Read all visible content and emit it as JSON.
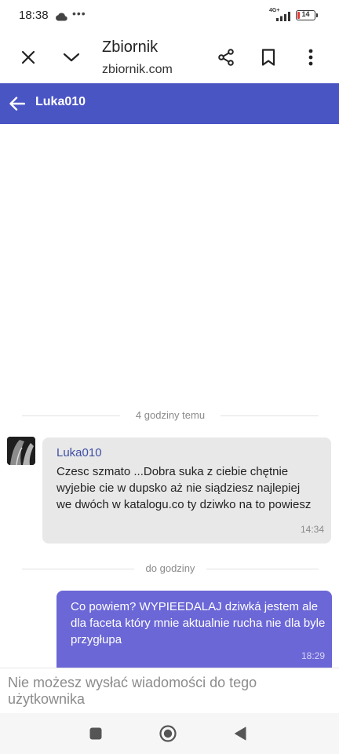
{
  "status_bar": {
    "time": "18:38",
    "network": "4G+",
    "battery": "14",
    "icons": [
      "cloud-icon",
      "more-dots-icon",
      "signal-icon",
      "battery-icon"
    ]
  },
  "browser": {
    "title": "Zbiornik",
    "url": "zbiornik.com",
    "icons": [
      "close-icon",
      "chevron-down-icon",
      "share-icon",
      "bookmark-icon",
      "more-vert-icon"
    ]
  },
  "header": {
    "title": "Luka010",
    "background": "#4a55c4"
  },
  "chat": {
    "dividers": [
      "4 godziny temu",
      "do godziny"
    ],
    "messages": [
      {
        "direction": "incoming",
        "sender": "Luka010",
        "text": "Czesc szmato ...Dobra suka z ciebie chętnie wyjebie cie w dupsko aż nie siądziesz najlepiej we dwóch w katalogu.co ty dziwko na to powiesz",
        "time": "14:34",
        "bubble_color": "#e8e8e8"
      },
      {
        "direction": "outgoing",
        "text": "Co powiem? WYPIEEDALAJ dziwká jestem ale dla faceta który mnie aktualnie rucha nie dla byle przygłupa",
        "time": "18:29",
        "bubble_color": "#6b67d6"
      }
    ]
  },
  "footer": {
    "note": "Nie możesz wysłać wiadomości do tego użytkownika"
  },
  "nav": {
    "icons": [
      "recents-square-icon",
      "home-circle-icon",
      "back-triangle-icon"
    ]
  }
}
